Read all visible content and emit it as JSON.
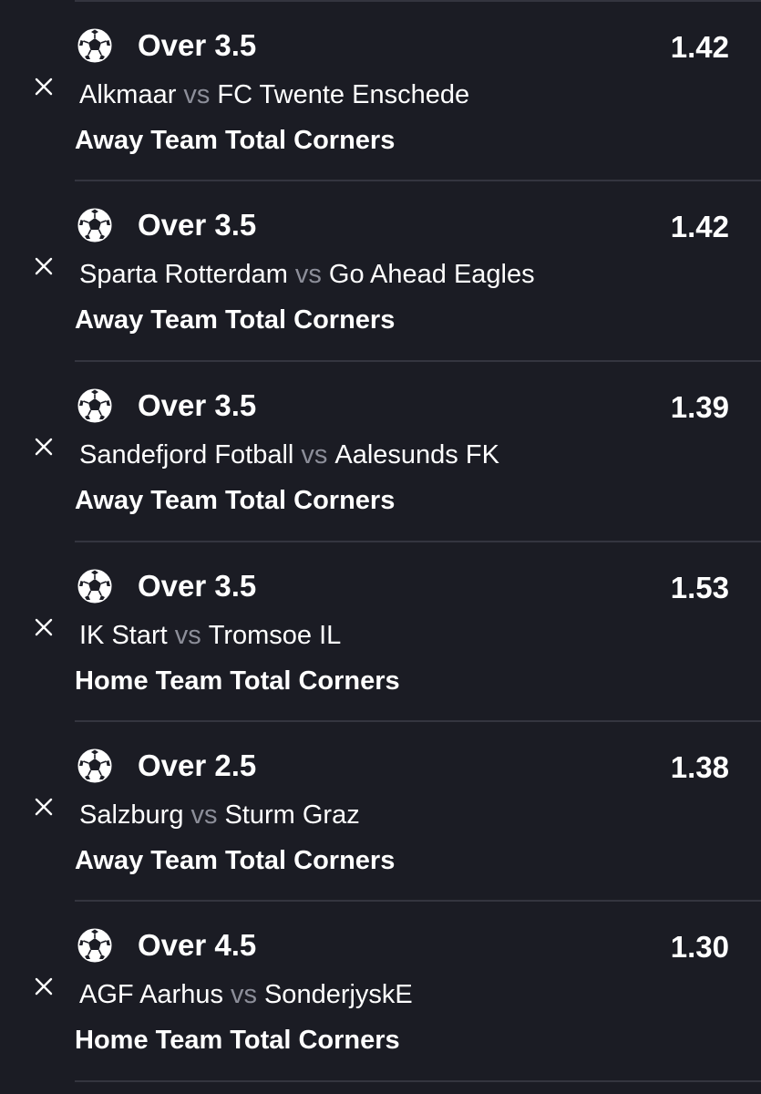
{
  "bets": [
    {
      "selection": "Over 3.5",
      "odds": "1.42",
      "home": "Alkmaar",
      "vs": "vs",
      "away": "FC Twente Enschede",
      "market": "Away Team Total Corners",
      "sport_icon": "soccer-ball-icon",
      "remove_icon": "close-icon"
    },
    {
      "selection": "Over 3.5",
      "odds": "1.42",
      "home": "Sparta Rotterdam",
      "vs": "vs",
      "away": "Go Ahead Eagles",
      "market": "Away Team Total Corners",
      "sport_icon": "soccer-ball-icon",
      "remove_icon": "close-icon"
    },
    {
      "selection": "Over 3.5",
      "odds": "1.39",
      "home": "Sandefjord Fotball",
      "vs": "vs",
      "away": "Aalesunds FK",
      "market": "Away Team Total Corners",
      "sport_icon": "soccer-ball-icon",
      "remove_icon": "close-icon"
    },
    {
      "selection": "Over 3.5",
      "odds": "1.53",
      "home": "IK Start",
      "vs": "vs",
      "away": "Tromsoe IL",
      "market": "Home Team Total Corners",
      "sport_icon": "soccer-ball-icon",
      "remove_icon": "close-icon"
    },
    {
      "selection": "Over 2.5",
      "odds": "1.38",
      "home": "Salzburg",
      "vs": "vs",
      "away": "Sturm Graz",
      "market": "Away Team Total Corners",
      "sport_icon": "soccer-ball-icon",
      "remove_icon": "close-icon"
    },
    {
      "selection": "Over 4.5",
      "odds": "1.30",
      "home": "AGF Aarhus",
      "vs": "vs",
      "away": "SonderjyskE",
      "market": "Home Team Total Corners",
      "sport_icon": "soccer-ball-icon",
      "remove_icon": "close-icon"
    }
  ],
  "colors": {
    "background": "#1b1c24",
    "divider": "#34353f",
    "text": "#ffffff",
    "vs_text": "#8c8e99"
  }
}
